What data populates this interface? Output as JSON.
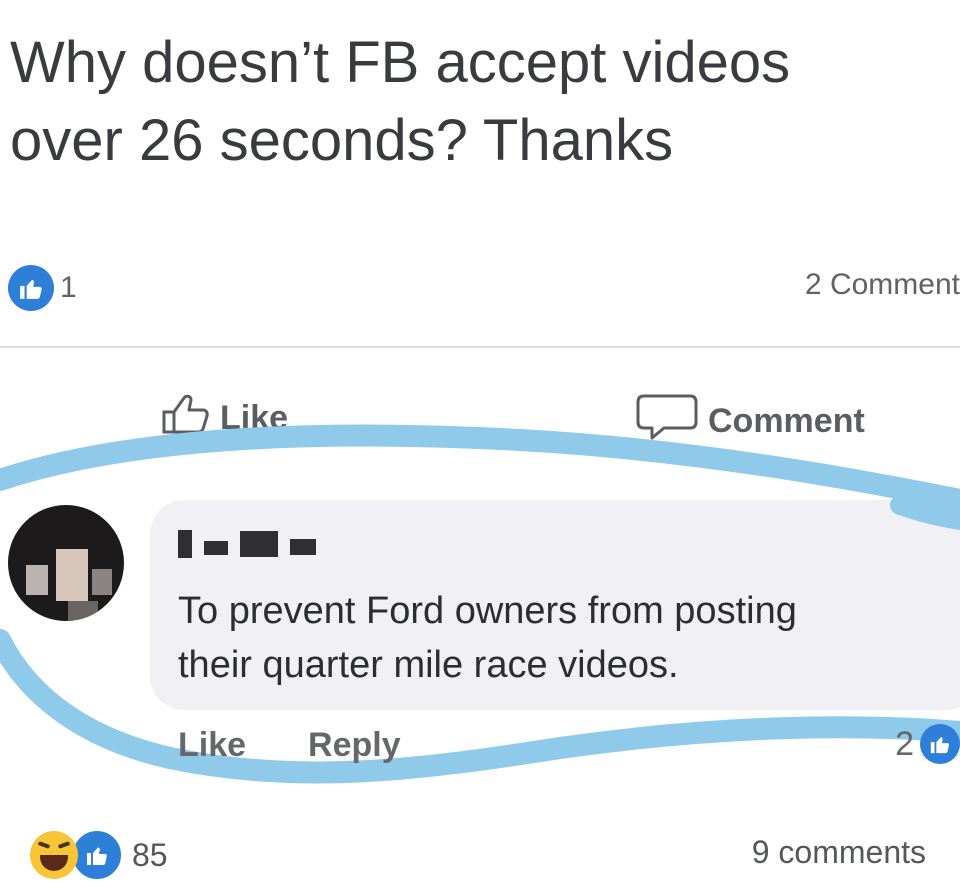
{
  "post": {
    "text_line1": "Why doesn’t FB accept videos",
    "text_line2": "over 26 seconds? Thanks",
    "like_count": "1",
    "comment_count": "2 Comment"
  },
  "actions": {
    "like_label": "Like",
    "comment_label": "Comment"
  },
  "comment": {
    "text_line1": "To prevent Ford owners from posting",
    "text_line2": "their quarter mile race videos.",
    "like_label": "Like",
    "reply_label": "Reply",
    "reaction_count": "2"
  },
  "footer": {
    "reaction_count": "85",
    "comments_label": "9 comments"
  },
  "colors": {
    "facebook_blue": "#2d7fd8",
    "highlight_blue": "#8fcaea",
    "bubble_gray": "#f1f0f4"
  },
  "icons": [
    "like-icon",
    "comment-icon",
    "haha-reaction-icon",
    "like-reaction-icon"
  ]
}
